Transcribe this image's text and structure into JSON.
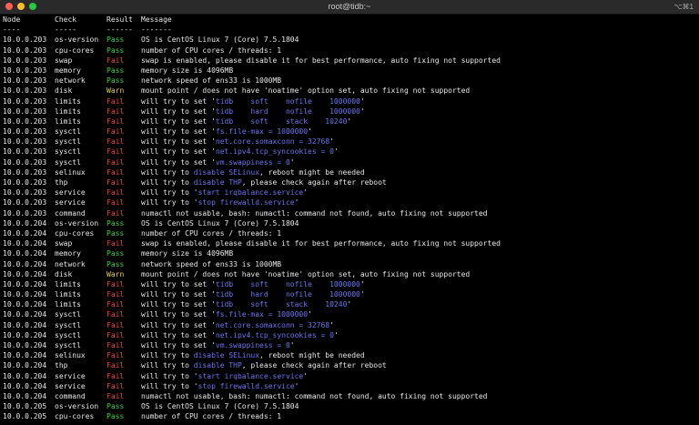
{
  "window": {
    "title": "root@tidb:~",
    "shortcut": "⌥⌘1"
  },
  "colors": {
    "pass": "#3dd13d",
    "fail": "#e8453c",
    "warn": "#e5d23a",
    "highlight": "#6f74ee"
  },
  "terminal": {
    "header": {
      "node": "Node",
      "check": "Check",
      "result": "Result",
      "message": "Message"
    },
    "separator": {
      "node": "----",
      "check": "-----",
      "result": "------",
      "message": "-------"
    },
    "rows": [
      {
        "node": "10.0.0.203",
        "check": "os-version",
        "result": "Pass",
        "msg": [
          {
            "t": "OS is CentOS Linux 7 (Core) 7.5.1804"
          }
        ]
      },
      {
        "node": "10.0.0.203",
        "check": "cpu-cores",
        "result": "Pass",
        "msg": [
          {
            "t": "number of CPU cores / threads: 1"
          }
        ]
      },
      {
        "node": "10.0.0.203",
        "check": "swap",
        "result": "Fail",
        "msg": [
          {
            "t": "swap is enabled, please disable it for best performance, auto fixing not supported"
          }
        ]
      },
      {
        "node": "10.0.0.203",
        "check": "memory",
        "result": "Pass",
        "msg": [
          {
            "t": "memory size is 4096MB"
          }
        ]
      },
      {
        "node": "10.0.0.203",
        "check": "network",
        "result": "Pass",
        "msg": [
          {
            "t": "network speed of ens33 is 1000MB"
          }
        ]
      },
      {
        "node": "10.0.0.203",
        "check": "disk",
        "result": "Warn",
        "msg": [
          {
            "t": "mount point / does not have 'noatime' option set, auto fixing not supported"
          }
        ]
      },
      {
        "node": "10.0.0.203",
        "check": "limits",
        "result": "Fail",
        "msg": [
          {
            "t": "will try to set '"
          },
          {
            "t": "tidb    soft    nofile    1000000",
            "h": 1
          },
          {
            "t": "'"
          }
        ]
      },
      {
        "node": "10.0.0.203",
        "check": "limits",
        "result": "Fail",
        "msg": [
          {
            "t": "will try to set '"
          },
          {
            "t": "tidb    hard    nofile    1000000",
            "h": 1
          },
          {
            "t": "'"
          }
        ]
      },
      {
        "node": "10.0.0.203",
        "check": "limits",
        "result": "Fail",
        "msg": [
          {
            "t": "will try to set '"
          },
          {
            "t": "tidb    soft    stack    10240",
            "h": 1
          },
          {
            "t": "'"
          }
        ]
      },
      {
        "node": "10.0.0.203",
        "check": "sysctl",
        "result": "Fail",
        "msg": [
          {
            "t": "will try to set '"
          },
          {
            "t": "fs.file-max = 1000000",
            "h": 1
          },
          {
            "t": "'"
          }
        ]
      },
      {
        "node": "10.0.0.203",
        "check": "sysctl",
        "result": "Fail",
        "msg": [
          {
            "t": "will try to set '"
          },
          {
            "t": "net.core.somaxconn = 32768",
            "h": 1
          },
          {
            "t": "'"
          }
        ]
      },
      {
        "node": "10.0.0.203",
        "check": "sysctl",
        "result": "Fail",
        "msg": [
          {
            "t": "will try to set '"
          },
          {
            "t": "net.ipv4.tcp_syncookies = 0",
            "h": 1
          },
          {
            "t": "'"
          }
        ]
      },
      {
        "node": "10.0.0.203",
        "check": "sysctl",
        "result": "Fail",
        "msg": [
          {
            "t": "will try to set '"
          },
          {
            "t": "vm.swappiness = 0",
            "h": 1
          },
          {
            "t": "'"
          }
        ]
      },
      {
        "node": "10.0.0.203",
        "check": "selinux",
        "result": "Fail",
        "msg": [
          {
            "t": "will try to "
          },
          {
            "t": "disable SELinux",
            "h": 1
          },
          {
            "t": ", reboot might be needed"
          }
        ]
      },
      {
        "node": "10.0.0.203",
        "check": "thp",
        "result": "Fail",
        "msg": [
          {
            "t": "will try to "
          },
          {
            "t": "disable THP",
            "h": 1
          },
          {
            "t": ", please check again after reboot"
          }
        ]
      },
      {
        "node": "10.0.0.203",
        "check": "service",
        "result": "Fail",
        "msg": [
          {
            "t": "will try to '"
          },
          {
            "t": "start irqbalance.service",
            "h": 1
          },
          {
            "t": "'"
          }
        ]
      },
      {
        "node": "10.0.0.203",
        "check": "service",
        "result": "Fail",
        "msg": [
          {
            "t": "will try to '"
          },
          {
            "t": "stop firewalld.service",
            "h": 1
          },
          {
            "t": "'"
          }
        ]
      },
      {
        "node": "10.0.0.203",
        "check": "command",
        "result": "Fail",
        "msg": [
          {
            "t": "numactl not usable, bash: numactl: command not found, auto fixing not supported"
          }
        ]
      },
      {
        "node": "10.0.0.204",
        "check": "os-version",
        "result": "Pass",
        "msg": [
          {
            "t": "OS is CentOS Linux 7 (Core) 7.5.1804"
          }
        ]
      },
      {
        "node": "10.0.0.204",
        "check": "cpu-cores",
        "result": "Pass",
        "msg": [
          {
            "t": "number of CPU cores / threads: 1"
          }
        ]
      },
      {
        "node": "10.0.0.204",
        "check": "swap",
        "result": "Fail",
        "msg": [
          {
            "t": "swap is enabled, please disable it for best performance, auto fixing not supported"
          }
        ]
      },
      {
        "node": "10.0.0.204",
        "check": "memory",
        "result": "Pass",
        "msg": [
          {
            "t": "memory size is 4096MB"
          }
        ]
      },
      {
        "node": "10.0.0.204",
        "check": "network",
        "result": "Pass",
        "msg": [
          {
            "t": "network speed of ens33 is 1000MB"
          }
        ]
      },
      {
        "node": "10.0.0.204",
        "check": "disk",
        "result": "Warn",
        "msg": [
          {
            "t": "mount point / does not have 'noatime' option set, auto fixing not supported"
          }
        ]
      },
      {
        "node": "10.0.0.204",
        "check": "limits",
        "result": "Fail",
        "msg": [
          {
            "t": "will try to set '"
          },
          {
            "t": "tidb    soft    nofile    1000000",
            "h": 1
          },
          {
            "t": "'"
          }
        ]
      },
      {
        "node": "10.0.0.204",
        "check": "limits",
        "result": "Fail",
        "msg": [
          {
            "t": "will try to set '"
          },
          {
            "t": "tidb    hard    nofile    1000000",
            "h": 1
          },
          {
            "t": "'"
          }
        ]
      },
      {
        "node": "10.0.0.204",
        "check": "limits",
        "result": "Fail",
        "msg": [
          {
            "t": "will try to set '"
          },
          {
            "t": "tidb    soft    stack    10240",
            "h": 1
          },
          {
            "t": "'"
          }
        ]
      },
      {
        "node": "10.0.0.204",
        "check": "sysctl",
        "result": "Fail",
        "msg": [
          {
            "t": "will try to set '"
          },
          {
            "t": "fs.file-max = 1000000",
            "h": 1
          },
          {
            "t": "'"
          }
        ]
      },
      {
        "node": "10.0.0.204",
        "check": "sysctl",
        "result": "Fail",
        "msg": [
          {
            "t": "will try to set '"
          },
          {
            "t": "net.core.somaxconn = 32768",
            "h": 1
          },
          {
            "t": "'"
          }
        ]
      },
      {
        "node": "10.0.0.204",
        "check": "sysctl",
        "result": "Fail",
        "msg": [
          {
            "t": "will try to set '"
          },
          {
            "t": "net.ipv4.tcp_syncookies = 0",
            "h": 1
          },
          {
            "t": "'"
          }
        ]
      },
      {
        "node": "10.0.0.204",
        "check": "sysctl",
        "result": "Fail",
        "msg": [
          {
            "t": "will try to set '"
          },
          {
            "t": "vm.swappiness = 0",
            "h": 1
          },
          {
            "t": "'"
          }
        ]
      },
      {
        "node": "10.0.0.204",
        "check": "selinux",
        "result": "Fail",
        "msg": [
          {
            "t": "will try to "
          },
          {
            "t": "disable SELinux",
            "h": 1
          },
          {
            "t": ", reboot might be needed"
          }
        ]
      },
      {
        "node": "10.0.0.204",
        "check": "thp",
        "result": "Fail",
        "msg": [
          {
            "t": "will try to "
          },
          {
            "t": "disable THP",
            "h": 1
          },
          {
            "t": ", please check again after reboot"
          }
        ]
      },
      {
        "node": "10.0.0.204",
        "check": "service",
        "result": "Fail",
        "msg": [
          {
            "t": "will try to '"
          },
          {
            "t": "start irqbalance.service",
            "h": 1
          },
          {
            "t": "'"
          }
        ]
      },
      {
        "node": "10.0.0.204",
        "check": "service",
        "result": "Fail",
        "msg": [
          {
            "t": "will try to '"
          },
          {
            "t": "stop firewalld.service",
            "h": 1
          },
          {
            "t": "'"
          }
        ]
      },
      {
        "node": "10.0.0.204",
        "check": "command",
        "result": "Fail",
        "msg": [
          {
            "t": "numactl not usable, bash: numactl: command not found, auto fixing not supported"
          }
        ]
      },
      {
        "node": "10.0.0.205",
        "check": "os-version",
        "result": "Pass",
        "msg": [
          {
            "t": "OS is CentOS Linux 7 (Core) 7.5.1804"
          }
        ]
      },
      {
        "node": "10.0.0.205",
        "check": "cpu-cores",
        "result": "Pass",
        "msg": [
          {
            "t": "number of CPU cores / threads: 1"
          }
        ]
      }
    ]
  }
}
